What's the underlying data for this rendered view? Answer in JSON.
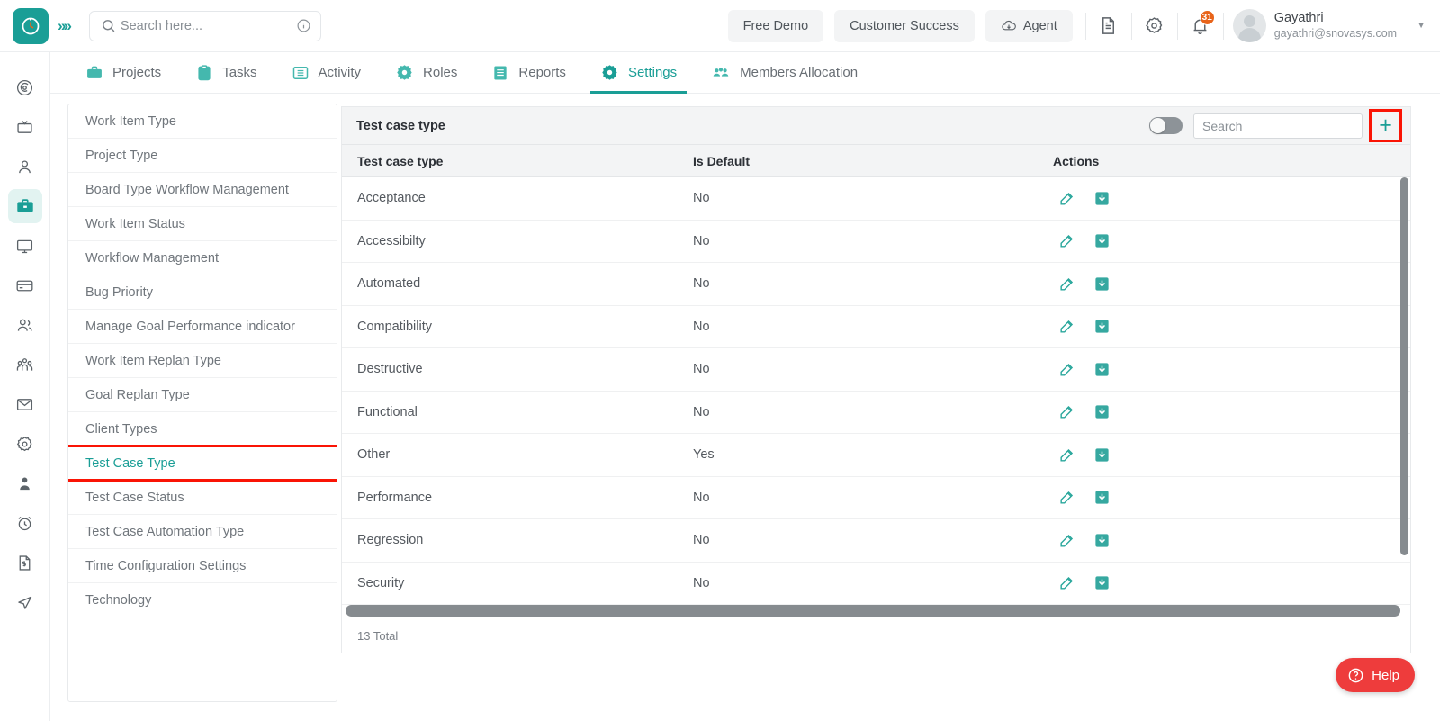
{
  "topbar": {
    "logo_icon": "clock-logo-icon",
    "expand_icon": "chevron-double-right-icon",
    "search": {
      "placeholder": "Search here...",
      "value": "",
      "icon": "search-icon",
      "info_icon": "info-icon"
    },
    "buttons": [
      {
        "label": "Free Demo",
        "name": "free-demo-button",
        "icon": ""
      },
      {
        "label": "Customer Success",
        "name": "customer-success-button",
        "icon": ""
      },
      {
        "label": "Agent",
        "name": "agent-button",
        "icon": "cloud-download-icon"
      }
    ],
    "icons": [
      {
        "name": "document-icon"
      },
      {
        "name": "gear-icon"
      },
      {
        "name": "bell-icon"
      }
    ],
    "notification_count": "31",
    "user": {
      "name": "Gayathri",
      "email": "gayathri@snovasys.com",
      "avatar": "avatar",
      "caret": "chevron-down-icon"
    }
  },
  "nav": {
    "tabs": [
      {
        "label": "Projects",
        "icon": "briefcase-icon",
        "active": false
      },
      {
        "label": "Tasks",
        "icon": "clipboard-icon",
        "active": false
      },
      {
        "label": "Activity",
        "icon": "list-box-icon",
        "active": false
      },
      {
        "label": "Roles",
        "icon": "gear-icon",
        "active": false
      },
      {
        "label": "Reports",
        "icon": "report-icon",
        "active": false
      },
      {
        "label": "Settings",
        "icon": "gear-icon",
        "active": true
      },
      {
        "label": "Members Allocation",
        "icon": "people-icon",
        "active": false
      }
    ]
  },
  "rail": {
    "items": [
      {
        "name": "dashboard-target-icon",
        "active": false
      },
      {
        "name": "tv-icon",
        "active": false
      },
      {
        "name": "person-outline-icon",
        "active": false
      },
      {
        "name": "briefcase-icon",
        "active": true
      },
      {
        "name": "monitor-icon",
        "active": false
      },
      {
        "name": "card-icon",
        "active": false
      },
      {
        "name": "users-icon",
        "active": false
      },
      {
        "name": "team-icon",
        "active": false
      },
      {
        "name": "mail-icon",
        "active": false
      },
      {
        "name": "gear-icon",
        "active": false
      },
      {
        "name": "user-solid-icon",
        "active": false
      },
      {
        "name": "alarm-clock-icon",
        "active": false
      },
      {
        "name": "invoice-icon",
        "active": false
      },
      {
        "name": "send-icon",
        "active": false
      }
    ]
  },
  "sidebar": {
    "items": [
      {
        "label": "Work Item Type",
        "selected": false
      },
      {
        "label": "Project Type",
        "selected": false
      },
      {
        "label": "Board Type Workflow Management",
        "selected": false
      },
      {
        "label": "Work Item Status",
        "selected": false
      },
      {
        "label": "Workflow Management",
        "selected": false
      },
      {
        "label": "Bug Priority",
        "selected": false
      },
      {
        "label": "Manage Goal Performance indicator",
        "selected": false
      },
      {
        "label": "Work Item Replan Type",
        "selected": false
      },
      {
        "label": "Goal Replan Type",
        "selected": false
      },
      {
        "label": "Client Types",
        "selected": false
      },
      {
        "label": "Test Case Type",
        "selected": true
      },
      {
        "label": "Test Case Status",
        "selected": false
      },
      {
        "label": "Test Case Automation Type",
        "selected": false
      },
      {
        "label": "Time Configuration Settings",
        "selected": false
      },
      {
        "label": "Technology",
        "selected": false
      }
    ]
  },
  "panel": {
    "title": "Test case type",
    "toggle": {
      "name": "show-archived-toggle",
      "on": false
    },
    "search": {
      "placeholder": "Search",
      "value": ""
    },
    "add_button": {
      "label": "+",
      "name": "add-test-case-type-button"
    },
    "columns": [
      "Test case type",
      "Is Default",
      "Actions"
    ],
    "rows": [
      {
        "name": "Acceptance",
        "is_default": "No"
      },
      {
        "name": "Accessibilty",
        "is_default": "No"
      },
      {
        "name": "Automated",
        "is_default": "No"
      },
      {
        "name": "Compatibility",
        "is_default": "No"
      },
      {
        "name": "Destructive",
        "is_default": "No"
      },
      {
        "name": "Functional",
        "is_default": "No"
      },
      {
        "name": "Other",
        "is_default": "Yes"
      },
      {
        "name": "Performance",
        "is_default": "No"
      },
      {
        "name": "Regression",
        "is_default": "No"
      },
      {
        "name": "Security",
        "is_default": "No"
      }
    ],
    "row_actions": [
      {
        "name": "edit-row-button",
        "icon": "edit-pencil-icon"
      },
      {
        "name": "archive-row-button",
        "icon": "archive-down-arrow-icon"
      }
    ],
    "total_text": "13 Total"
  },
  "help": {
    "label": "Help",
    "icon": "question-circle-icon"
  },
  "colors": {
    "accent": "#1a9e96",
    "annotation": "#fa1405",
    "badge": "#e8641a",
    "help": "#ee3c3c",
    "header_bg": "#f3f4f5"
  }
}
